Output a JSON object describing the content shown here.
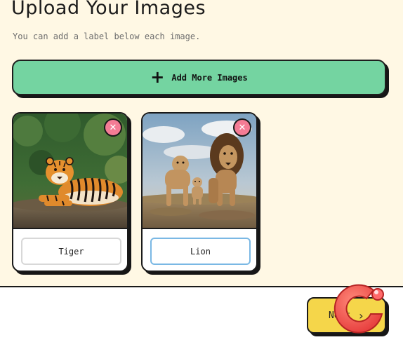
{
  "header": {
    "title": "Upload Your Images",
    "subtitle": "You can add a label below each image."
  },
  "add_button": {
    "icon": "plus-icon",
    "label": "Add More Images"
  },
  "cards": [
    {
      "image_subject": "tiger",
      "remove_icon": "close-icon",
      "label_value": "Tiger",
      "focused": false
    },
    {
      "image_subject": "lions",
      "remove_icon": "close-icon",
      "label_value": "Lion",
      "focused": true
    }
  ],
  "footer": {
    "next_label": "Next",
    "next_icon": "chevron-right-icon"
  },
  "colors": {
    "background": "#fff8e4",
    "add_button": "#74d4a1",
    "remove_button": "#f47c95",
    "next_button": "#f5d64a",
    "focus_border": "#7ab8e4"
  }
}
